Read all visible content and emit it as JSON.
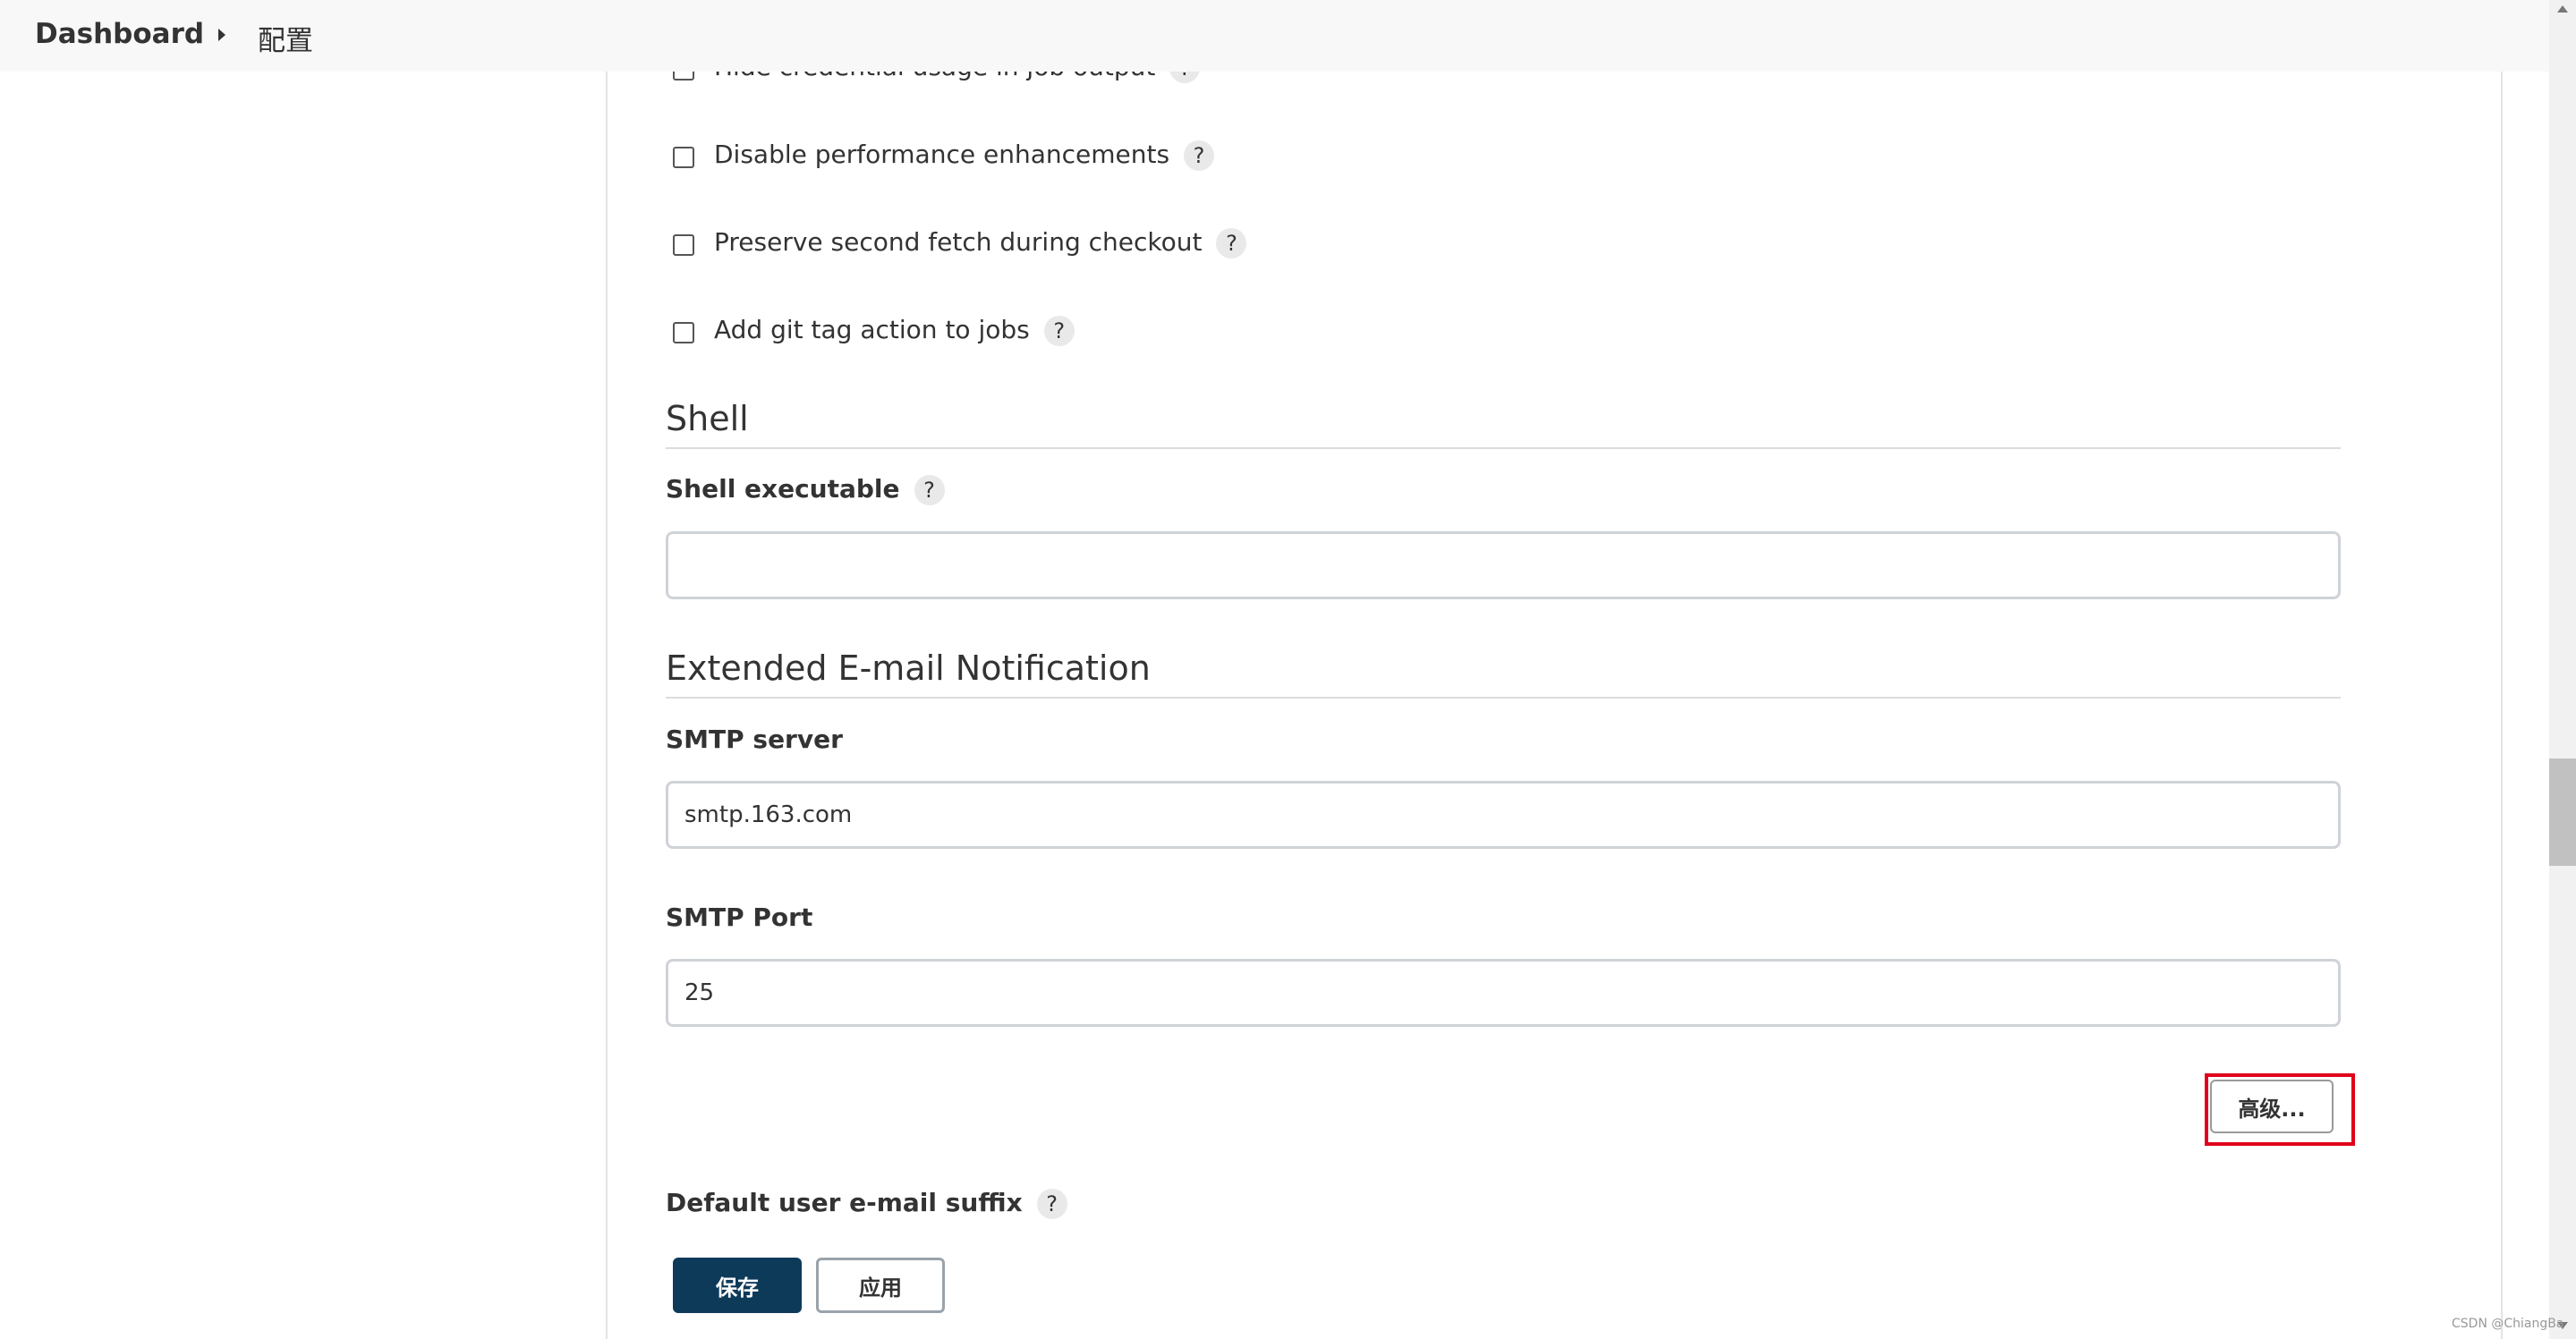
{
  "breadcrumb": {
    "home": "Dashboard",
    "current": "配置"
  },
  "git_options": [
    {
      "label": "Hide credential usage in job output",
      "help": "?"
    },
    {
      "label": "Disable performance enhancements",
      "help": "?"
    },
    {
      "label": "Preserve second fetch during checkout",
      "help": "?"
    },
    {
      "label": "Add git tag action to jobs",
      "help": "?"
    }
  ],
  "shell": {
    "title": "Shell",
    "executable_label": "Shell executable",
    "help": "?",
    "executable_value": ""
  },
  "email": {
    "title": "Extended E-mail Notification",
    "smtp_server_label": "SMTP server",
    "smtp_server_value": "smtp.163.com",
    "smtp_port_label": "SMTP Port",
    "smtp_port_value": "25",
    "advanced_label": "高级...",
    "default_suffix_label": "Default user e-mail suffix",
    "help": "?"
  },
  "actions": {
    "save_label": "保存",
    "apply_label": "应用"
  },
  "watermark": "CSDN @ChiangBa",
  "colors": {
    "save_bg": "#0e3a5a",
    "highlight": "#e0001b",
    "topbar_bg": "#f8f8f8"
  }
}
